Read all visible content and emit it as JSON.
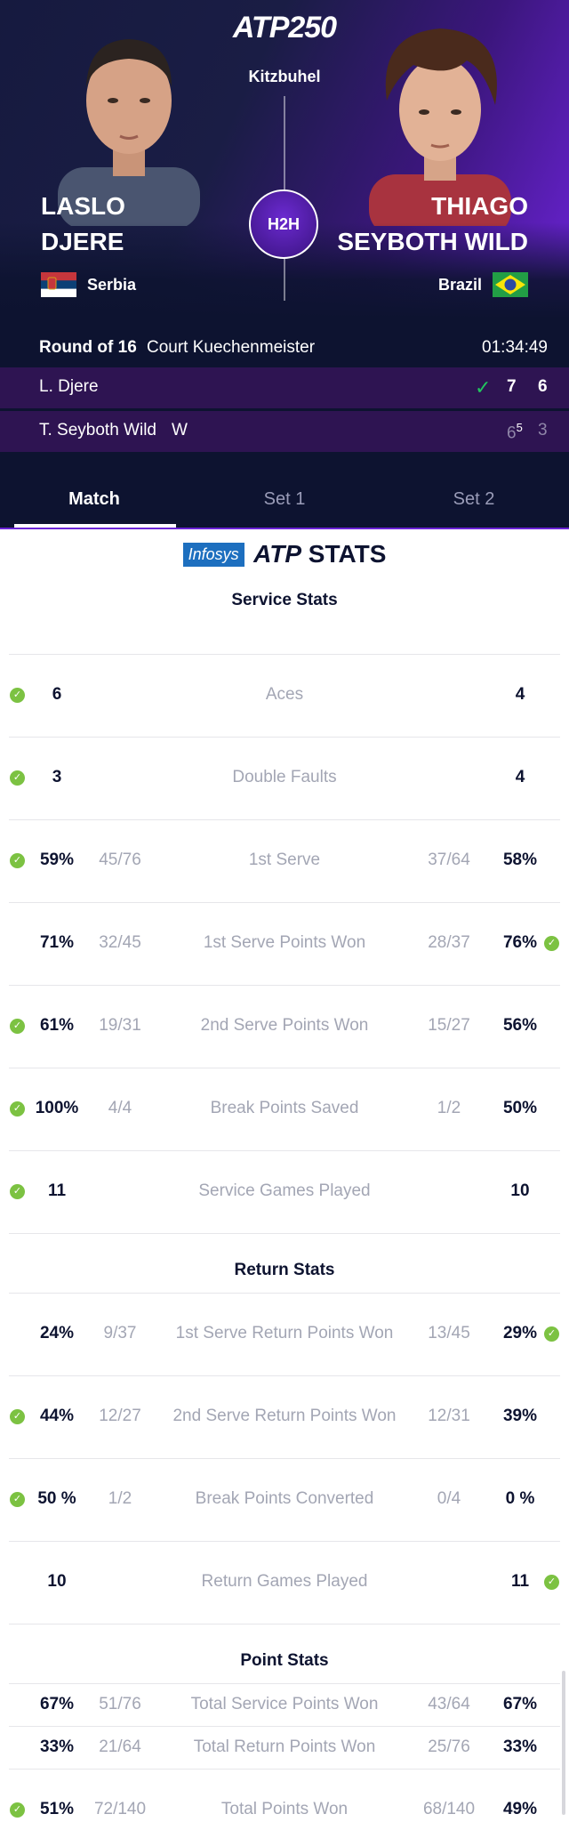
{
  "header": {
    "logo": "ATP250",
    "tournament": "Kitzbuhel",
    "h2h_label": "H2H",
    "player1": {
      "first": "LASLO",
      "last": "DJERE",
      "country": "Serbia"
    },
    "player2": {
      "first": "THIAGO",
      "last": "SEYBOTH WILD",
      "country": "Brazil"
    }
  },
  "match_info": {
    "round": "Round of 16",
    "court": "Court Kuechenmeister",
    "duration": "01:34:49"
  },
  "scoreboard": {
    "row1": {
      "name": "L. Djere",
      "winner_mark": "",
      "set1": "7",
      "set2": "6",
      "set1_tb": ""
    },
    "row2": {
      "name": "T. Seyboth Wild",
      "winner_mark": "W",
      "set1": "6",
      "set1_tb": "5",
      "set2": "3"
    }
  },
  "tabs": [
    {
      "label": "Match"
    },
    {
      "label": "Set 1"
    },
    {
      "label": "Set 2"
    }
  ],
  "stats_logo": {
    "sponsor": "Infosys",
    "brand": "ATP",
    "suffix": "STATS"
  },
  "sections": {
    "service": "Service Stats",
    "return": "Return Stats",
    "points": "Point Stats"
  },
  "service_stats": [
    {
      "label": "Aces",
      "left": "6",
      "left_sub": "",
      "right": "4",
      "right_sub": "",
      "leader": "left"
    },
    {
      "label": "Double Faults",
      "left": "3",
      "left_sub": "",
      "right": "4",
      "right_sub": "",
      "leader": "left"
    },
    {
      "label": "1st Serve",
      "left": "59%",
      "left_sub": "45/76",
      "right": "58%",
      "right_sub": "37/64",
      "leader": "left"
    },
    {
      "label": "1st Serve Points Won",
      "left": "71%",
      "left_sub": "32/45",
      "right": "76%",
      "right_sub": "28/37",
      "leader": "right"
    },
    {
      "label": "2nd Serve Points Won",
      "left": "61%",
      "left_sub": "19/31",
      "right": "56%",
      "right_sub": "15/27",
      "leader": "left"
    },
    {
      "label": "Break Points Saved",
      "left": "100%",
      "left_sub": "4/4",
      "right": "50%",
      "right_sub": "1/2",
      "leader": "left"
    },
    {
      "label": "Service Games Played",
      "left": "11",
      "left_sub": "",
      "right": "10",
      "right_sub": "",
      "leader": "left"
    }
  ],
  "return_stats": [
    {
      "label": "1st Serve Return Points Won",
      "left": "24%",
      "left_sub": "9/37",
      "right": "29%",
      "right_sub": "13/45",
      "leader": "right"
    },
    {
      "label": "2nd Serve Return Points Won",
      "left": "44%",
      "left_sub": "12/27",
      "right": "39%",
      "right_sub": "12/31",
      "leader": "left"
    },
    {
      "label": "Break Points Converted",
      "left": "50 %",
      "left_sub": "1/2",
      "right": "0 %",
      "right_sub": "0/4",
      "leader": "left"
    },
    {
      "label": "Return Games Played",
      "left": "10",
      "left_sub": "",
      "right": "11",
      "right_sub": "",
      "leader": "right"
    }
  ],
  "point_stats": [
    {
      "label": "Total Service Points Won",
      "left": "67%",
      "left_sub": "51/76",
      "right": "67%",
      "right_sub": "43/64",
      "leader": "none"
    },
    {
      "label": "Total Return Points Won",
      "left": "33%",
      "left_sub": "21/64",
      "right": "33%",
      "right_sub": "25/76",
      "leader": "none"
    },
    {
      "label": "Total Points Won",
      "left": "51%",
      "left_sub": "72/140",
      "right": "49%",
      "right_sub": "68/140",
      "leader": "left"
    }
  ],
  "colors": {
    "header_bg": "#0d1330",
    "accent_purple": "#6b23d6",
    "score_row_bg": "#2e1452",
    "leader_check": "#7cc242",
    "winner_check": "#22c55e"
  }
}
